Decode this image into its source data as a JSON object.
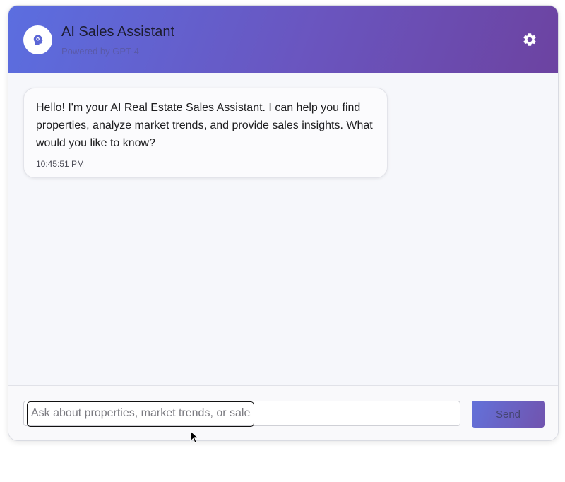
{
  "header": {
    "title": "AI Sales Assistant",
    "subtitle": "Powered by GPT-4",
    "avatar_icon": "brain-gear-icon",
    "settings_icon": "gear-icon"
  },
  "messages": [
    {
      "sender": "assistant",
      "text": "Hello! I'm your AI Real Estate Sales Assistant. I can help you find properties, analyze market trends, and provide sales insights. What would you like to know?",
      "time": "10:45:51 PM"
    }
  ],
  "composer": {
    "placeholder": "Ask about properties, market trends, or sales insights...",
    "value": "",
    "send_label": "Send"
  },
  "colors": {
    "header_gradient_start": "#5b6ee0",
    "header_gradient_end": "#6c43a1",
    "accent": "#6a55bf"
  }
}
